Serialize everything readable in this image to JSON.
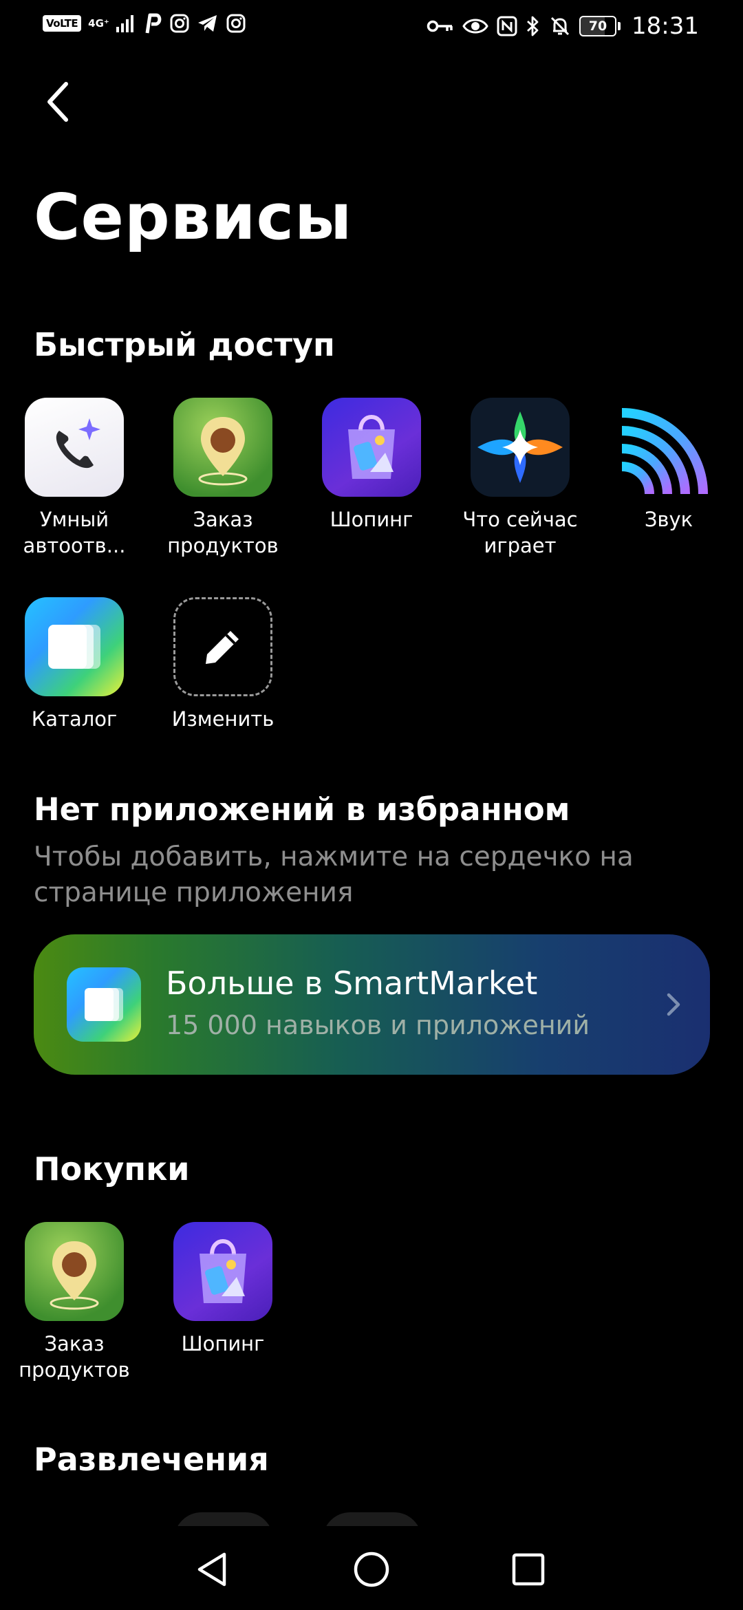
{
  "status_bar": {
    "volte": "VoLTE",
    "network": "4G⁺",
    "time": "18:31",
    "battery": "70",
    "left_icons": [
      "signal-icon",
      "p-icon",
      "instagram-icon",
      "telegram-icon",
      "instagram-icon"
    ],
    "right_icons": [
      "key-icon",
      "eye-icon",
      "nfc-icon",
      "bluetooth-icon",
      "bell-off-icon"
    ]
  },
  "header": {
    "title": "Сервисы"
  },
  "quick_access": {
    "title": "Быстрый доступ",
    "items": [
      {
        "label": "Умный автоотв...",
        "icon": "smart-call-icon"
      },
      {
        "label": "Заказ продуктов",
        "icon": "grocery-pin-icon"
      },
      {
        "label": "Шопинг",
        "icon": "shopping-bag-icon"
      },
      {
        "label": "Что сейчас играет",
        "icon": "music-recognition-icon"
      },
      {
        "label": "Звук",
        "icon": "sound-waves-icon"
      },
      {
        "label": "Каталог",
        "icon": "catalog-icon"
      },
      {
        "label": "Изменить",
        "icon": "pencil-icon"
      }
    ]
  },
  "favorites": {
    "empty_title": "Нет приложений в избранном",
    "empty_text": "Чтобы добавить, нажмите на сердечко на странице приложения"
  },
  "banner": {
    "title": "Больше в SmartMarket",
    "subtitle": "15 000 навыков и приложений"
  },
  "purchases": {
    "title": "Покупки",
    "items": [
      {
        "label": "Заказ продуктов",
        "icon": "grocery-pin-icon"
      },
      {
        "label": "Шопинг",
        "icon": "shopping-bag-icon"
      }
    ]
  },
  "entertainment": {
    "title": "Развлечения"
  },
  "nav": [
    "back-triangle-icon",
    "home-circle-icon",
    "recents-square-icon"
  ]
}
